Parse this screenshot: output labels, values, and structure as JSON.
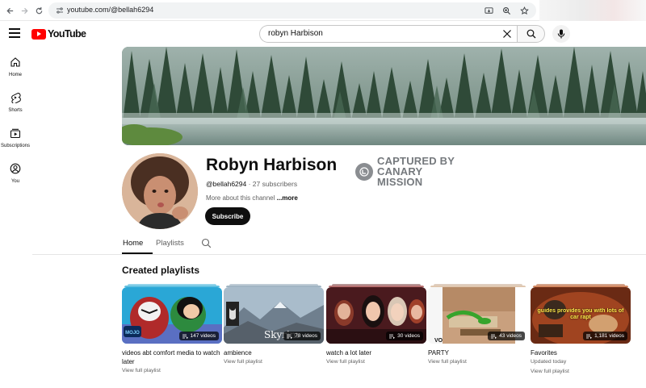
{
  "browser": {
    "url": "youtube.com/@bellah6294"
  },
  "masthead": {
    "logo_text": "YouTube",
    "search_value": "robyn Harbison"
  },
  "guide": [
    {
      "label": "Home",
      "icon": "home-icon"
    },
    {
      "label": "Shorts",
      "icon": "shorts-icon"
    },
    {
      "label": "Subscriptions",
      "icon": "subscriptions-icon"
    },
    {
      "label": "You",
      "icon": "you-icon"
    }
  ],
  "channel": {
    "name": "Robyn Harbison",
    "handle": "@bellah6294",
    "separator": " · ",
    "subscribers": "27 subscribers",
    "about_text": "More about this channel",
    "more_label": "...more",
    "subscribe_label": "Subscribe",
    "watermark": "CAPTURED BY CANARY MISSION"
  },
  "tabs": [
    {
      "label": "Home",
      "active": true
    },
    {
      "label": "Playlists",
      "active": false
    }
  ],
  "section": {
    "title": "Created playlists"
  },
  "playlists": [
    {
      "title": "videos abt comfort media to watch later",
      "count": "147 videos",
      "thumb_text": "MOJO",
      "sub": "",
      "link": "View full playlist",
      "accent": "#3ab0d8"
    },
    {
      "title": "ambience",
      "count": "78 videos",
      "thumb_text": "Skyrim",
      "sub": "",
      "link": "View full playlist",
      "accent": "#8aa2b4"
    },
    {
      "title": "watch a lot later",
      "count": "30 videos",
      "thumb_text": "",
      "sub": "",
      "link": "View full playlist",
      "accent": "#7a3d3d"
    },
    {
      "title": "PARTY",
      "count": "43 videos",
      "thumb_text": "VO",
      "sub": "",
      "link": "View full playlist",
      "accent": "#c4a58a"
    },
    {
      "title": "Favorites",
      "count": "1,181 videos",
      "thumb_text": "guides provides you with lots of car rapt",
      "sub": "Updated today",
      "link": "View full playlist",
      "accent": "#b0572b"
    }
  ],
  "colors": {
    "brand_red": "#ff0000",
    "text_primary": "#0f0f0f",
    "text_secondary": "#606060",
    "subscribe_bg": "#0f0f0f"
  }
}
